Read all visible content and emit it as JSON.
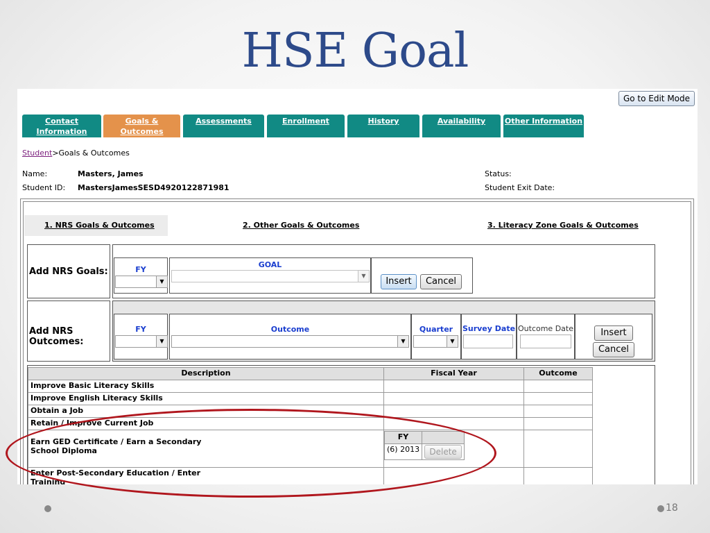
{
  "slide": {
    "title": "HSE Goal",
    "page_number": "18"
  },
  "toolbar": {
    "edit_mode_label": "Go to Edit Mode"
  },
  "tabs": [
    {
      "label": "Contact Information",
      "active": false
    },
    {
      "label": "Goals & Outcomes",
      "active": true
    },
    {
      "label": "Assessments",
      "active": false
    },
    {
      "label": "Enrollment",
      "active": false
    },
    {
      "label": "History",
      "active": false
    },
    {
      "label": "Availability",
      "active": false
    },
    {
      "label": "Other Information",
      "active": false
    }
  ],
  "breadcrumb": {
    "link": "Student",
    "sep": ">",
    "current": "Goals & Outcomes"
  },
  "student": {
    "name_label": "Name:",
    "name": "Masters, James",
    "id_label": "Student ID:",
    "id": "MastersJamesSESD4920122871981",
    "status_label": "Status:",
    "exit_label": "Student Exit Date:"
  },
  "subtabs": [
    "1. NRS Goals & Outcomes",
    "2. Other Goals & Outcomes",
    "3. Literacy Zone Goals & Outcomes"
  ],
  "add_goals": {
    "label": "Add NRS Goals:",
    "fy_header": "FY",
    "goal_header": "GOAL",
    "insert": "Insert",
    "cancel": "Cancel"
  },
  "add_outcomes": {
    "label": "Add NRS Outcomes:",
    "fy_header": "FY",
    "outcome_header": "Outcome",
    "quarter_header": "Quarter",
    "survey_header": "Survey Date",
    "outcome_date_header": "Outcome Date",
    "insert": "Insert",
    "cancel": "Cancel"
  },
  "goals_table": {
    "headers": [
      "Description",
      "Fiscal Year",
      "Outcome"
    ],
    "rows": [
      "Improve Basic Literacy Skills",
      "Improve English Literacy Skills",
      "Obtain a Job",
      "Retain / Improve Current Job",
      "Earn GED Certificate / Earn a Secondary School Diploma",
      "Enter Post-Secondary Education / Enter Training"
    ],
    "fy_sub": {
      "header": "FY",
      "value": "(6) 2013",
      "delete": "Delete"
    }
  },
  "colors": {
    "tab": "#118a84",
    "tab_active": "#e4924b",
    "title": "#2d4a8a",
    "highlight": "#b0161d"
  }
}
